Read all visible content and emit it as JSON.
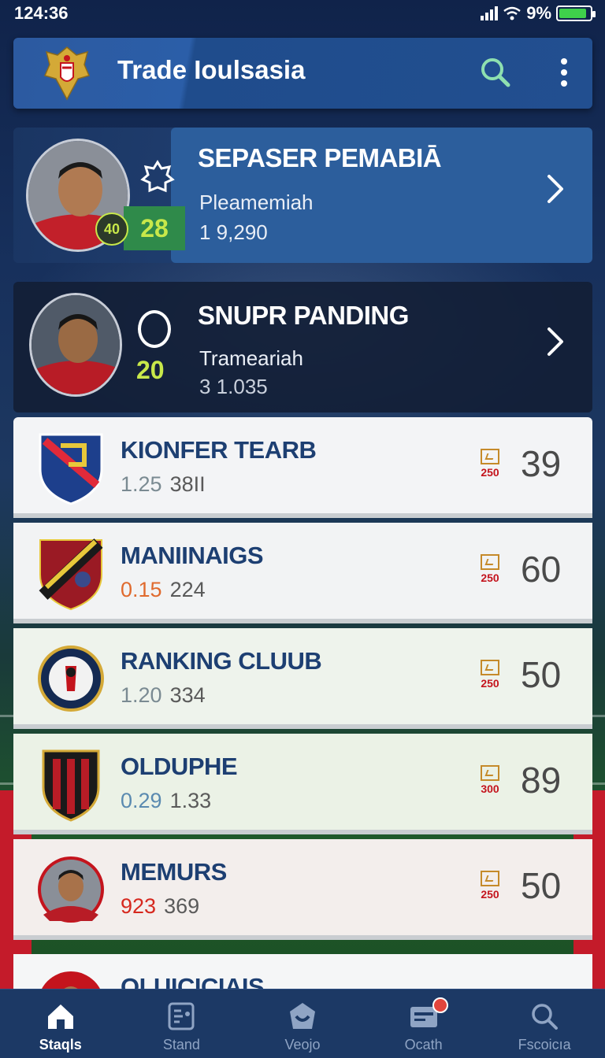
{
  "status_bar": {
    "time": "124:36",
    "battery": "9%",
    "battery_level": 0.9
  },
  "header": {
    "title": "Trade Ioulsasia",
    "logo_icon": "eagle-crest-icon",
    "search_icon": "search-icon",
    "menu_icon": "more-vertical-icon"
  },
  "featured": [
    {
      "title": "SEPASER PEMABIĀ",
      "subtitle": "Pleamemiah",
      "value": "1 9,290",
      "rank": "28",
      "badge_text": "40",
      "icon": "gear-icon"
    },
    {
      "title": "SNUPR PANDING",
      "subtitle": "Trameariah",
      "value": "3 1.035",
      "rank": "20",
      "badge_text": "",
      "icon": "circle-icon"
    }
  ],
  "rankings": [
    {
      "name": "KIONFER TEARB",
      "stat_a": "1.25",
      "stat_b": "38II",
      "badge": "250",
      "score": "39",
      "stat_a_color": "#7a8a92"
    },
    {
      "name": "MANIINAIGS",
      "stat_a": "0.15",
      "stat_b": "224",
      "badge": "250",
      "score": "60",
      "stat_a_color": "#e06a2e"
    },
    {
      "name": "RANKING CLUUB",
      "stat_a": "1.20",
      "stat_b": "334",
      "badge": "250",
      "score": "50",
      "stat_a_color": "#7a8a92"
    },
    {
      "name": "OLDUPHE",
      "stat_a": "0.29",
      "stat_b": "1.33",
      "badge": "300",
      "score": "89",
      "stat_a_color": "#5a8ab0"
    },
    {
      "name": "MEMURS",
      "stat_a": "923",
      "stat_b": "369",
      "badge": "250",
      "score": "50",
      "stat_a_color": "#d6281e"
    },
    {
      "name": "OLUICICIAIS",
      "stat_a": "",
      "stat_b": "",
      "badge": "",
      "score": ""
    }
  ],
  "bottom_nav": [
    {
      "label": "Staqls",
      "icon": "home-icon",
      "active": true
    },
    {
      "label": "Stand",
      "icon": "standings-icon",
      "active": false
    },
    {
      "label": "Veojo",
      "icon": "shield-icon",
      "active": false
    },
    {
      "label": "Ocath",
      "icon": "card-icon",
      "active": false
    },
    {
      "label": "Fscoicıa",
      "icon": "search-icon",
      "active": false
    }
  ],
  "colors": {
    "header_blue": "#2c5aa0",
    "team_name": "#1d3f72",
    "rank_green": "#c8e84a",
    "accent_red": "#c4141d"
  }
}
